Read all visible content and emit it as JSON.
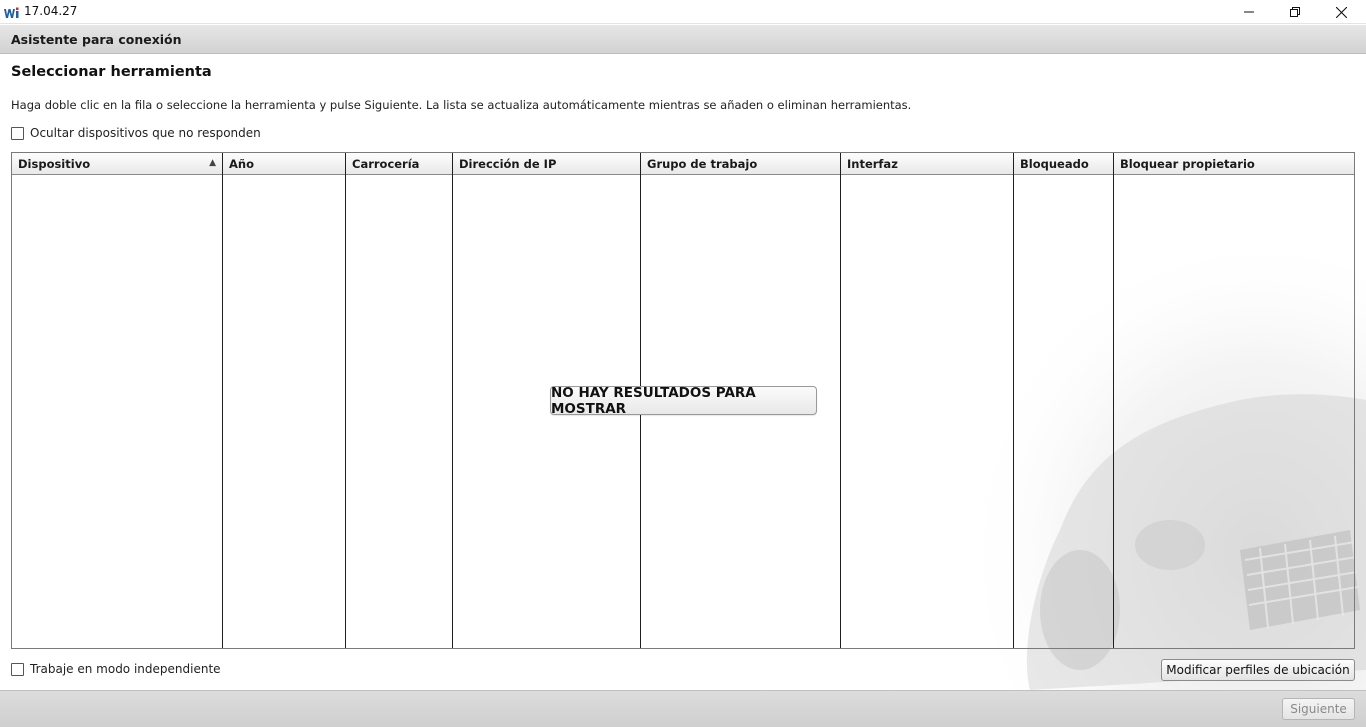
{
  "window": {
    "title": "17.04.27",
    "logo_icon": "wi-logo-icon",
    "controls": [
      "minimize-icon",
      "restore-icon",
      "close-icon"
    ]
  },
  "header": {
    "title": "Asistente para conexión"
  },
  "main": {
    "section_title": "Seleccionar herramienta",
    "instructions": "Haga doble clic en la fila o seleccione la herramienta y pulse Siguiente. La lista se actualiza automáticamente mientras se añaden o eliminan herramientas.",
    "hide_unresponsive_label": "Ocultar dispositivos que no responden",
    "hide_unresponsive_checked": false
  },
  "table": {
    "columns": [
      {
        "label": "Dispositivo",
        "sorted": "ascending"
      },
      {
        "label": "Año"
      },
      {
        "label": "Carrocería"
      },
      {
        "label": "Dirección de IP"
      },
      {
        "label": "Grupo de trabajo"
      },
      {
        "label": "Interfaz"
      },
      {
        "label": "Bloqueado"
      },
      {
        "label": "Bloquear propietario"
      }
    ],
    "rows": [],
    "empty_message": "NO HAY RESULTADOS PARA MOSTRAR"
  },
  "bottom": {
    "standalone_label": "Trabaje en modo independiente",
    "standalone_checked": false,
    "profiles_button": "Modificar perfiles de ubicación"
  },
  "footer": {
    "next_button": "Siguiente",
    "next_enabled": false
  },
  "colors": {
    "header_bg": "#d9d9d9",
    "grid_line": "#1f1f1f",
    "disabled_text": "#8a8a8a"
  }
}
